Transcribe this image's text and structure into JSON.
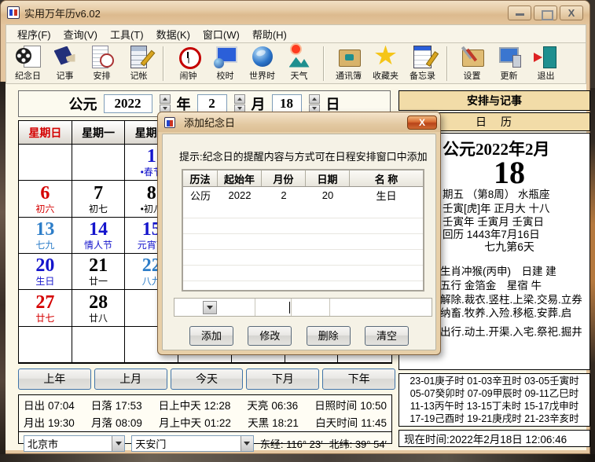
{
  "window": {
    "title": "实用万年历v6.02"
  },
  "menu": {
    "items": [
      "程序(F)",
      "查询(V)",
      "工具(T)",
      "数据(K)",
      "窗口(W)",
      "帮助(H)"
    ]
  },
  "toolbar": {
    "groups": [
      [
        {
          "label": "纪念日",
          "icon": "reel"
        },
        {
          "label": "记事",
          "icon": "notes"
        },
        {
          "label": "安排",
          "icon": "sched"
        },
        {
          "label": "记帐",
          "icon": "calc"
        }
      ],
      [
        {
          "label": "闹钟",
          "icon": "alarm"
        },
        {
          "label": "校时",
          "icon": "synctime"
        },
        {
          "label": "世界时",
          "icon": "globe"
        },
        {
          "label": "天气",
          "icon": "weather"
        }
      ],
      [
        {
          "label": "通讯簿",
          "icon": "contacts"
        },
        {
          "label": "收藏夹",
          "icon": "star"
        },
        {
          "label": "备忘录",
          "icon": "memo"
        }
      ],
      [
        {
          "label": "设置",
          "icon": "settings"
        },
        {
          "label": "更新",
          "icon": "update"
        },
        {
          "label": "退出",
          "icon": "exit"
        }
      ]
    ]
  },
  "date_selector": {
    "era": "公元",
    "year": "2022",
    "year_unit": "年",
    "month": "2",
    "month_unit": "月",
    "day": "18",
    "day_unit": "日"
  },
  "calendar": {
    "headers": [
      "星期日",
      "星期一",
      "星期二",
      "",
      "",
      "",
      ""
    ],
    "header_colors": [
      "#d40000",
      "#000000",
      "#000000",
      "#000000",
      "#000000",
      "#000000",
      "#000000"
    ],
    "cells": [
      {
        "row": 0,
        "col": 2,
        "day": "1",
        "day_color": "#1414cc",
        "label": "•春节",
        "label_color": "#1414cc"
      },
      {
        "row": 1,
        "col": 0,
        "day": "6",
        "day_color": "#d40000",
        "label": "初六",
        "label_color": "#d40000"
      },
      {
        "row": 1,
        "col": 1,
        "day": "7",
        "day_color": "#000000",
        "label": "初七",
        "label_color": "#000000"
      },
      {
        "row": 1,
        "col": 2,
        "day": "8",
        "day_color": "#000000",
        "label": "•初八",
        "label_color": "#000000"
      },
      {
        "row": 2,
        "col": 0,
        "day": "13",
        "day_color": "#2d7dc8",
        "label": "七九",
        "label_color": "#2d7dc8"
      },
      {
        "row": 2,
        "col": 1,
        "day": "14",
        "day_color": "#1414cc",
        "label": "情人节",
        "label_color": "#1414cc"
      },
      {
        "row": 2,
        "col": 2,
        "day": "15",
        "day_color": "#1414cc",
        "label": "元宵节",
        "label_color": "#1414cc"
      },
      {
        "row": 3,
        "col": 0,
        "day": "20",
        "day_color": "#1414cc",
        "label": "生日",
        "label_color": "#1414cc"
      },
      {
        "row": 3,
        "col": 1,
        "day": "21",
        "day_color": "#000000",
        "label": "廿一",
        "label_color": "#000000"
      },
      {
        "row": 3,
        "col": 2,
        "day": "22",
        "day_color": "#2d7dc8",
        "label": "八九",
        "label_color": "#2d7dc8"
      },
      {
        "row": 4,
        "col": 0,
        "day": "27",
        "day_color": "#d40000",
        "label": "廿七",
        "label_color": "#d40000"
      },
      {
        "row": 4,
        "col": 1,
        "day": "28",
        "day_color": "#000000",
        "label": "廿八",
        "label_color": "#000000"
      }
    ]
  },
  "nav": {
    "items": [
      "上年",
      "上月",
      "今天",
      "下月",
      "下年"
    ]
  },
  "sun_info": {
    "line1": [
      [
        "日出",
        "07:04"
      ],
      [
        "日落",
        "17:53"
      ],
      [
        "日上中天",
        "12:28"
      ],
      [
        "天亮",
        "06:36"
      ],
      [
        "日照时间",
        "10:50"
      ]
    ],
    "line2": [
      [
        "月出",
        "19:30"
      ],
      [
        "月落",
        "08:09"
      ],
      [
        "月上中天",
        "01:22"
      ],
      [
        "天黑",
        "18:21"
      ],
      [
        "白天时间",
        "11:45"
      ]
    ]
  },
  "location": {
    "city": "北京市",
    "place": "天安门",
    "longitude": "东经: 116° 23′",
    "latitude": "北纬: 39° 54′"
  },
  "right_panel": {
    "header": "安排与记事",
    "tab": "日　历",
    "month_title": "公元2022年2月",
    "day_number": "18",
    "info_lines": [
      "期五 （第8周） 水瓶座",
      "壬寅[虎]年 正月大 十八",
      "壬寅年 壬寅月 壬寅日",
      "回历 1443年7月16日"
    ],
    "nine_days": "七九第6天",
    "nine_days_color": "#1a56cc",
    "almanac_lines": [
      "生肖冲猴(丙申)　日建 建",
      "五行 金箔金　星宿 牛",
      "解除.裁衣.竖柱.上梁.交易.立券",
      "纳畜.牧养.入殓.移柩.安葬.启",
      "出行.动土.开渠.入宅.祭祀.掘井"
    ],
    "hours": [
      [
        "23-01庚子时",
        "01-03辛丑时",
        "03-05壬寅时"
      ],
      [
        "05-07癸卯时",
        "07-09甲辰时",
        "09-11乙巳时"
      ],
      [
        "11-13丙午时",
        "13-15丁未时",
        "15-17戊申时"
      ],
      [
        "17-19己酉时",
        "19-21庚戌时",
        "21-23辛亥时"
      ]
    ],
    "now_time": "现在时间:2022年2月18日  12:06:46"
  },
  "dialog": {
    "title": "添加纪念日",
    "hint": "提示:纪念日的提醒内容与方式可在日程安排窗口中添加",
    "table": {
      "headers": [
        "历法",
        "起始年",
        "月份",
        "日期",
        "名  称"
      ],
      "rows": [
        [
          "公历",
          "2022",
          "2",
          "20",
          "生日"
        ]
      ]
    },
    "buttons": [
      "添加",
      "修改",
      "删除",
      "清空"
    ]
  },
  "colors": {
    "red": "#d40000",
    "blue": "#1414cc",
    "light_blue": "#2d7dc8",
    "wheat": "#f2dca8",
    "title_tan": "#e2c39c"
  }
}
